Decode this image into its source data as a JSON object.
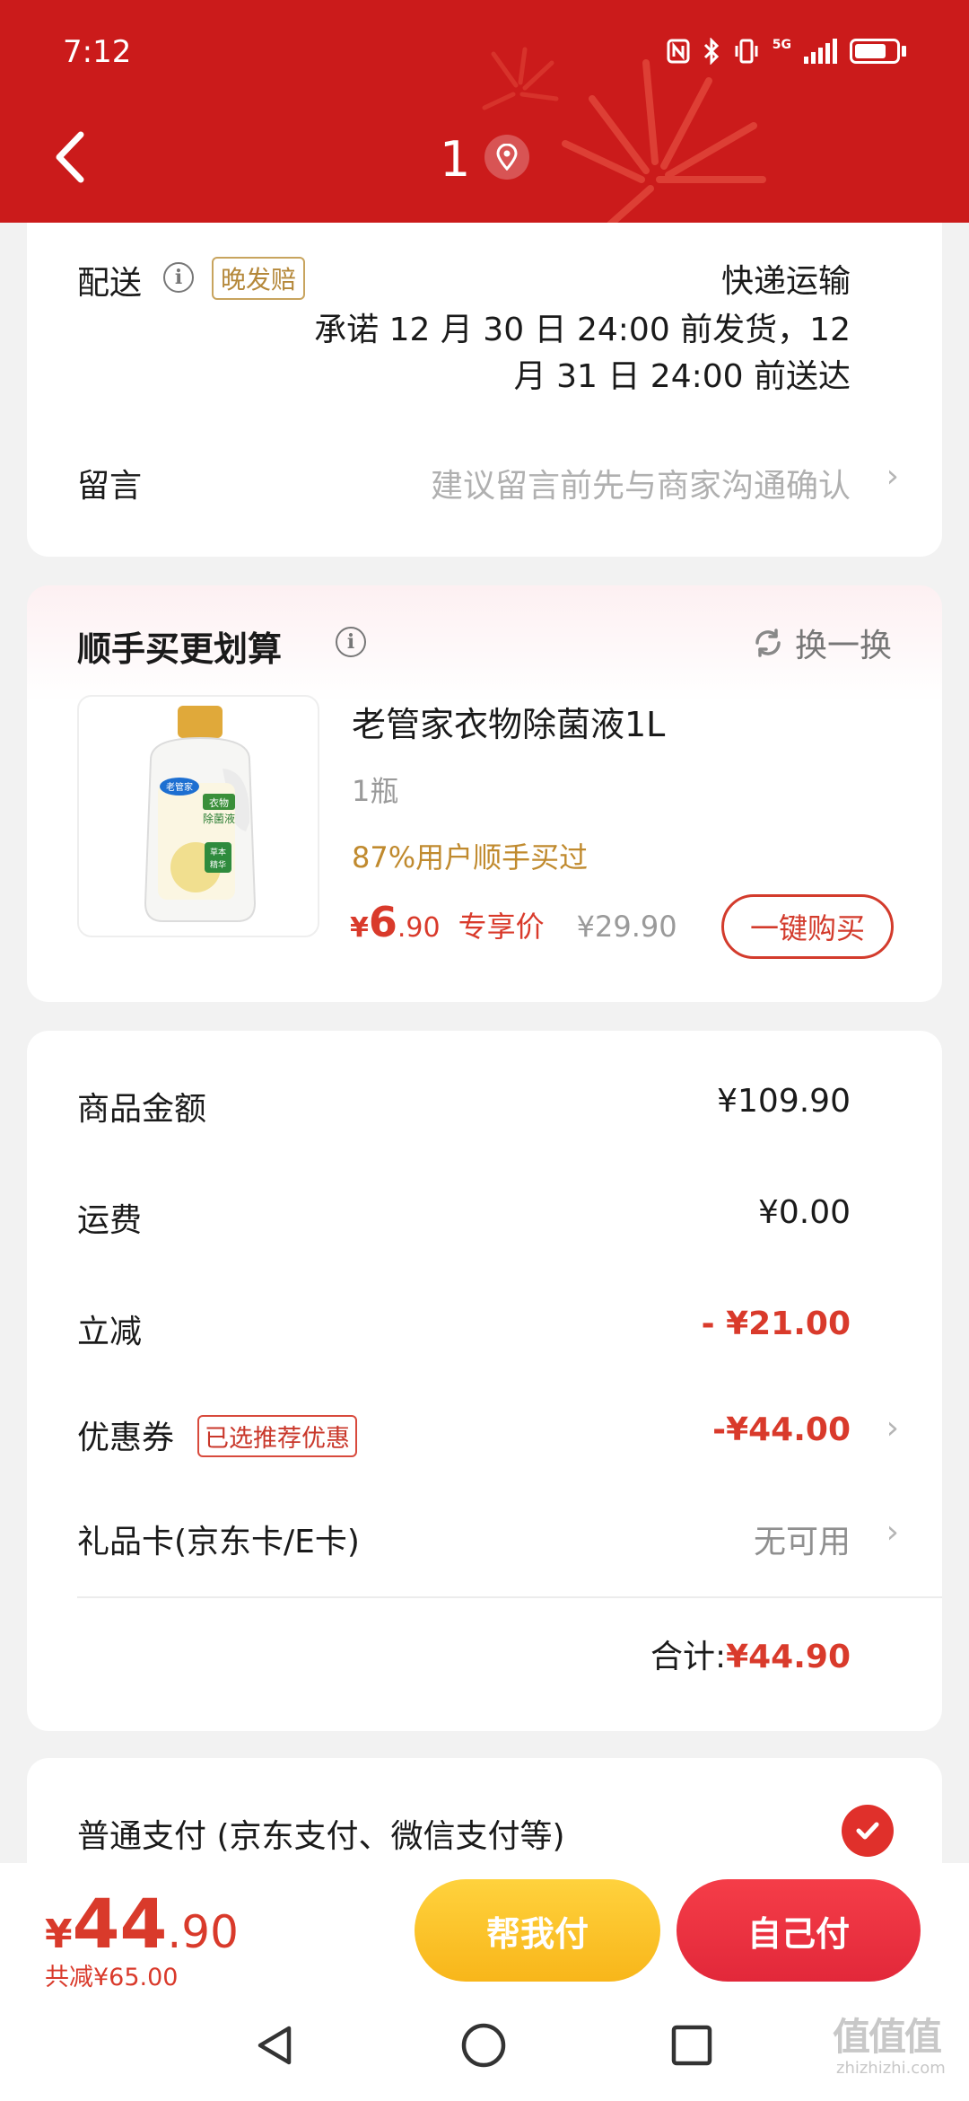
{
  "status_bar": {
    "time": "7:12",
    "network": "5G"
  },
  "header": {
    "title": "1"
  },
  "delivery": {
    "label": "配送",
    "tag": "晚发赔",
    "method": "快递运输",
    "promise_line1": "承诺 12 月 30 日 24:00 前发货，12",
    "promise_line2": "月 31 日 24:00 前送达"
  },
  "message": {
    "label": "留言",
    "placeholder": "建议留言前先与商家沟通确认"
  },
  "addon": {
    "title": "顺手买更划算",
    "refresh_label": "换一换",
    "product": {
      "name": "老管家衣物除菌液1L",
      "quantity": "1瓶",
      "popularity": "87%用户顺手买过",
      "price_symbol": "¥",
      "price_int": "6",
      "price_dec": ".90",
      "price_tag": "专享价",
      "original_price": "¥29.90",
      "buy_label": "一键购买",
      "image_text_1": "老管家",
      "image_text_2": "衣物",
      "image_text_3": "除菌液",
      "image_text_4": "草本",
      "image_text_5": "精华"
    }
  },
  "summary": {
    "goods_label": "商品金额",
    "goods_value": "¥109.90",
    "shipping_label": "运费",
    "shipping_value": "¥0.00",
    "discount_label": "立减",
    "discount_value": "- ¥21.00",
    "coupon_label": "优惠券",
    "coupon_tag": "已选推荐优惠",
    "coupon_value": "-¥44.00",
    "giftcard_label": "礼品卡(京东卡/E卡)",
    "giftcard_value": "无可用",
    "total_label": "合计:",
    "total_value": "¥44.90"
  },
  "payment": {
    "method_label": "普通支付 (京东支付、微信支付等)"
  },
  "bottom": {
    "price_symbol": "¥",
    "price_int": "44",
    "price_dec": ".90",
    "saved": "共减¥65.00",
    "help_pay": "帮我付",
    "self_pay": "自己付"
  },
  "watermark": {
    "text": "值值值",
    "url": "zhizhizhi.com"
  },
  "colors": {
    "header_red": "#cb1b1b",
    "price_red": "#d93a2b",
    "gold": "#b5883a",
    "help_yellow": "#ffc72c",
    "self_red": "#ea2f3f"
  }
}
